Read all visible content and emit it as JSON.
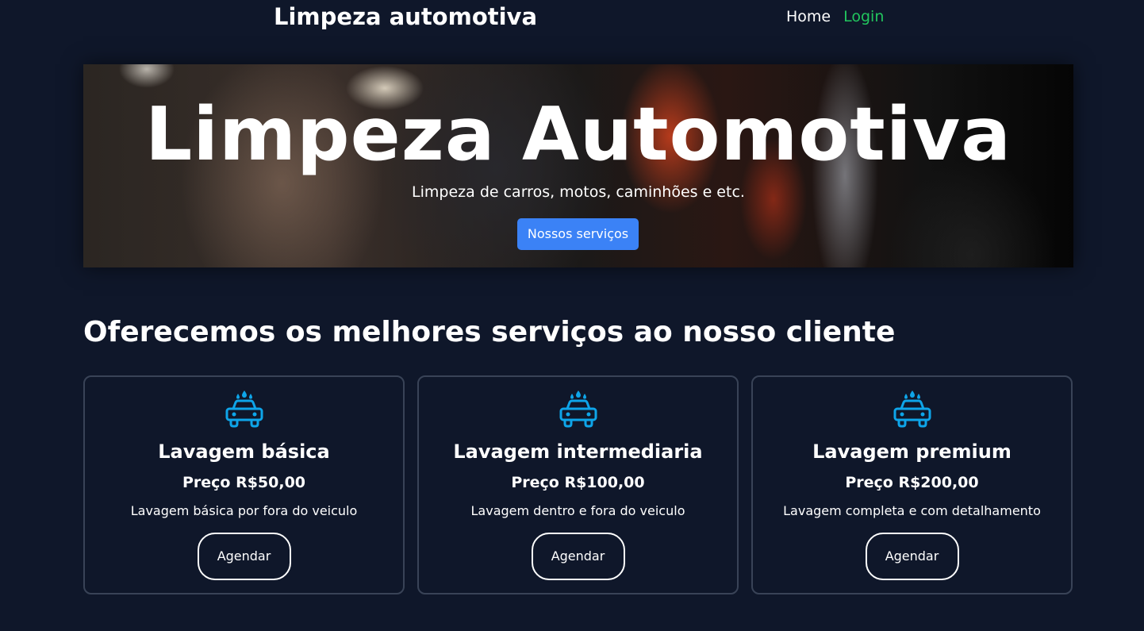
{
  "header": {
    "brand": "Limpeza automotiva",
    "nav": {
      "home": "Home",
      "login": "Login"
    }
  },
  "hero": {
    "title": "Limpeza Automotiva",
    "subtitle": "Limpeza de carros, motos, caminhões e etc.",
    "button_label": "Nossos serviços"
  },
  "services": {
    "title": "Oferecemos os melhores serviços ao nosso cliente",
    "cards": [
      {
        "icon": "car-wash-icon",
        "title": "Lavagem básica",
        "price": "Preço R$50,00",
        "description": "Lavagem básica por fora do veiculo",
        "button_label": "Agendar"
      },
      {
        "icon": "car-wash-icon",
        "title": "Lavagem intermediaria",
        "price": "Preço R$100,00",
        "description": "Lavagem dentro e fora do veiculo",
        "button_label": "Agendar"
      },
      {
        "icon": "car-wash-icon",
        "title": "Lavagem premium",
        "price": "Preço R$200,00",
        "description": "Lavagem completa e com detalhamento",
        "button_label": "Agendar"
      }
    ]
  },
  "colors": {
    "background": "#0f172a",
    "primary_button": "#3b82f6",
    "login_link": "#22c55e",
    "icon": "#0ea5e9",
    "card_border": "#394357"
  }
}
